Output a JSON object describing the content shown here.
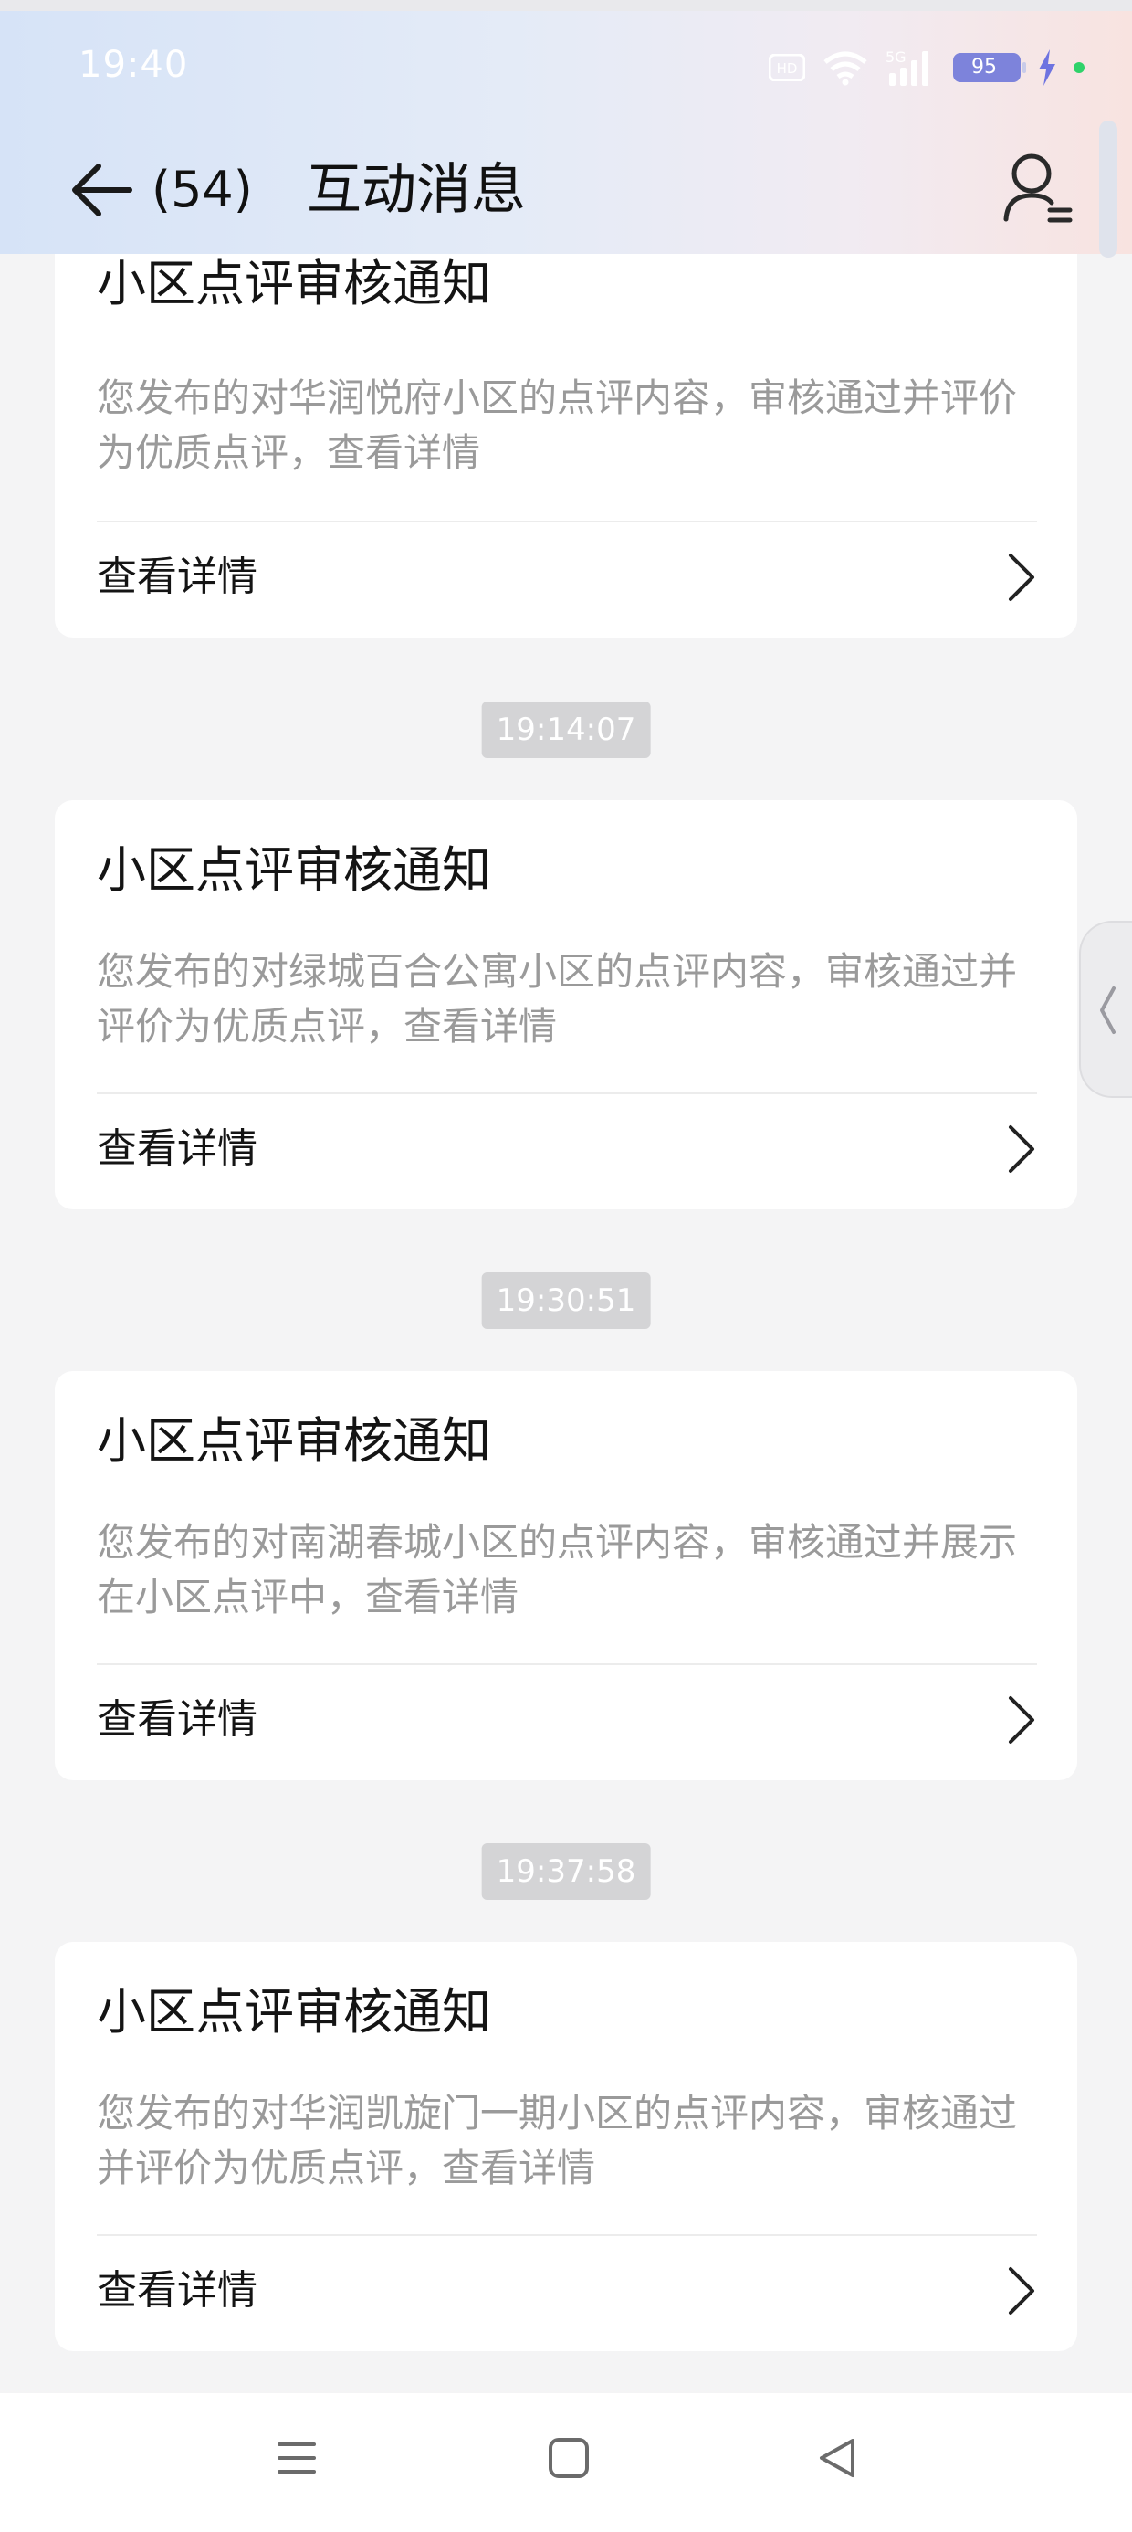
{
  "status_bar": {
    "time": "19:40",
    "battery": "95",
    "icons": [
      "hd-icon",
      "wifi-icon",
      "signal-5g-icon",
      "battery-icon",
      "charging-icon"
    ]
  },
  "header": {
    "count": "(54)",
    "title": "互动消息"
  },
  "messages": [
    {
      "time": "",
      "title": "小区点评审核通知",
      "body": "您发布的对华润悦府小区的点评内容，审核通过并评价为优质点评，查看详情",
      "link": "查看详情"
    },
    {
      "time": "19:14:07",
      "title": "小区点评审核通知",
      "body": "您发布的对绿城百合公寓小区的点评内容，审核通过并评价为优质点评，查看详情",
      "link": "查看详情"
    },
    {
      "time": "19:30:51",
      "title": "小区点评审核通知",
      "body": "您发布的对南湖春城小区的点评内容，审核通过并展示在小区点评中，查看详情",
      "link": "查看详情"
    },
    {
      "time": "19:37:58",
      "title": "小区点评审核通知",
      "body": "您发布的对华润凯旋门一期小区的点评内容，审核通过并评价为优质点评，查看详情",
      "link": "查看详情"
    }
  ],
  "colors": {
    "header_gradient": [
      "#d6e3f7",
      "#f8e3e0"
    ],
    "battery": "#7d83db",
    "time_chip": "#d4d4d6",
    "body_text": "#9a9a9a"
  }
}
